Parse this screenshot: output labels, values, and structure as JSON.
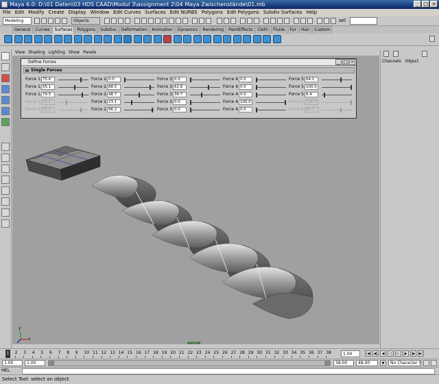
{
  "window": {
    "title": "Maya 6.0: D:\\01 Daten\\03 HDS CAAD\\Modul 3\\assignment 2\\04 Maya Zwischenstände\\01.mb",
    "buttons": [
      "_",
      "□",
      "×"
    ]
  },
  "menubar": {
    "items": [
      "File",
      "Edit",
      "Modify",
      "Create",
      "Display",
      "Window",
      "Edit Curves",
      "Surfaces",
      "Edit NURBS",
      "Polygons",
      "Edit Polygons",
      "Subdiv Surfaces",
      "Help"
    ]
  },
  "statusline": {
    "mode": "Modeling",
    "selection_mode": "Objects",
    "select_label": "sel"
  },
  "shelf": {
    "tabs": [
      "General",
      "Curves",
      "Surfaces",
      "Polygons",
      "Subdivs",
      "Deformation",
      "Animation",
      "Dynamics",
      "Rendering",
      "PaintEffects",
      "Cloth",
      "Fluids",
      "Fur",
      "Hair",
      "Custom"
    ],
    "active_tab": "Surfaces"
  },
  "viewport": {
    "menu": [
      "View",
      "Shading",
      "Lighting",
      "Show",
      "Panels"
    ],
    "camera_label": "persp",
    "axis_x": "x",
    "axis_y": "y"
  },
  "right_panel": {
    "tabs": [
      "Channels",
      "Object"
    ]
  },
  "dialog": {
    "title": "Define Forces",
    "section": "Single Forces",
    "forces": [
      [
        {
          "label": "Force 1.1",
          "value": "75.6",
          "level": 0.76,
          "enabled": true
        },
        {
          "label": "Force 1.2",
          "value": "55.1",
          "level": 0.55,
          "enabled": true
        },
        {
          "label": "Force 1.3",
          "value": "79.5",
          "level": 0.8,
          "enabled": true
        },
        {
          "label": "Force 1.4",
          "value": "25.1",
          "level": 0.25,
          "enabled": false
        },
        {
          "label": "Force 1.5",
          "value": "75.6",
          "level": 0.76,
          "enabled": false
        }
      ],
      [
        {
          "label": "Force 2.1",
          "value": "0.0",
          "level": 0.0,
          "enabled": true
        },
        {
          "label": "Force 2.2",
          "value": "88.5",
          "level": 0.89,
          "enabled": true
        },
        {
          "label": "Force 2.3",
          "value": "48.7",
          "level": 0.49,
          "enabled": true
        },
        {
          "label": "Force 2.4",
          "value": "23.1",
          "level": 0.23,
          "enabled": true
        },
        {
          "label": "Force 2.5",
          "value": "96.2",
          "level": 0.96,
          "enabled": true
        }
      ],
      [
        {
          "label": "Force 3.1",
          "value": "0.0",
          "level": 0.0,
          "enabled": true
        },
        {
          "label": "Force 3.2",
          "value": "62.8",
          "level": 0.63,
          "enabled": true
        },
        {
          "label": "Force 3.3",
          "value": "38.7",
          "level": 0.39,
          "enabled": true
        },
        {
          "label": "Force 3.4",
          "value": "0.0",
          "level": 0.0,
          "enabled": true
        },
        {
          "label": "Force 3.5",
          "value": "0.0",
          "level": 0.0,
          "enabled": true
        }
      ],
      [
        {
          "label": "Force 4.1",
          "value": "0.0",
          "level": 0.0,
          "enabled": true
        },
        {
          "label": "Force 4.2",
          "value": "0.0",
          "level": 0.0,
          "enabled": true
        },
        {
          "label": "Force 4.3",
          "value": "0.0",
          "level": 0.0,
          "enabled": true
        },
        {
          "label": "Force 4.4",
          "value": "100.0",
          "level": 1.0,
          "enabled": true
        },
        {
          "label": "Force 4.5",
          "value": "0.0",
          "level": 0.0,
          "enabled": true
        }
      ],
      [
        {
          "label": "Force 5.1",
          "value": "64.1",
          "level": 0.64,
          "enabled": true
        },
        {
          "label": "Force 5.2",
          "value": "100.0",
          "level": 1.0,
          "enabled": true
        },
        {
          "label": "Force 5.3",
          "value": "6.4",
          "level": 0.06,
          "enabled": true
        },
        {
          "label": "Force 5.4",
          "value": "100.0",
          "level": 1.0,
          "enabled": false
        },
        {
          "label": "Force 5.5",
          "value": "64.1",
          "level": 0.64,
          "enabled": false
        }
      ]
    ]
  },
  "timeline": {
    "ticks": [
      "1",
      "2",
      "3",
      "4",
      "5",
      "6",
      "7",
      "8",
      "9",
      "10",
      "11",
      "12",
      "13",
      "14",
      "15",
      "16",
      "17",
      "18",
      "19",
      "20",
      "21",
      "22",
      "23",
      "24",
      "25",
      "26",
      "27",
      "28",
      "29",
      "30",
      "31",
      "32",
      "33",
      "34",
      "35",
      "36",
      "37",
      "38"
    ],
    "current_frame": "1",
    "current_field": "1.00"
  },
  "range": {
    "start": "1.00",
    "inner_start": "1.00",
    "inner_end": "38.00",
    "end": "48.00",
    "character_set": "No Character Set"
  },
  "command": {
    "label": "MEL"
  },
  "helpline": {
    "text": "Select Tool: select an object"
  }
}
